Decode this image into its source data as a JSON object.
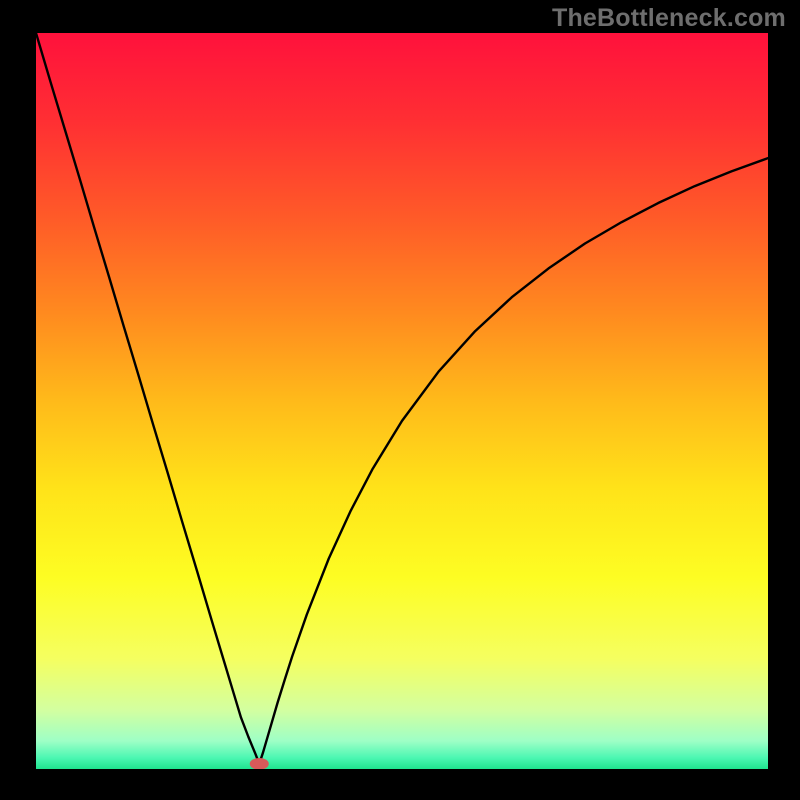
{
  "watermark": "TheBottleneck.com",
  "colors": {
    "gradient_stops": [
      {
        "offset": 0.0,
        "color": "#ff113c"
      },
      {
        "offset": 0.12,
        "color": "#ff2f33"
      },
      {
        "offset": 0.25,
        "color": "#ff5a28"
      },
      {
        "offset": 0.38,
        "color": "#ff8a1f"
      },
      {
        "offset": 0.5,
        "color": "#ffba1a"
      },
      {
        "offset": 0.62,
        "color": "#ffe319"
      },
      {
        "offset": 0.74,
        "color": "#fdfd23"
      },
      {
        "offset": 0.85,
        "color": "#f5ff60"
      },
      {
        "offset": 0.92,
        "color": "#d3ffa0"
      },
      {
        "offset": 0.962,
        "color": "#9effc6"
      },
      {
        "offset": 0.985,
        "color": "#4bf7b2"
      },
      {
        "offset": 1.0,
        "color": "#1fe38e"
      }
    ],
    "curve": "#000000",
    "marker": "#d85a5a",
    "background": "#000000"
  },
  "chart_data": {
    "type": "line",
    "title": "",
    "xlabel": "",
    "ylabel": "",
    "xlim": [
      0,
      100
    ],
    "ylim": [
      0,
      100
    ],
    "marker": {
      "x": 30.5,
      "y": 0.7,
      "rx": 1.3,
      "ry": 0.8
    },
    "series": [
      {
        "name": "bottleneck-curve",
        "x": [
          0,
          2,
          4,
          6,
          8,
          10,
          12,
          14,
          16,
          18,
          20,
          22,
          24,
          25,
          26,
          27,
          28,
          29,
          30,
          30.5,
          31,
          32,
          33,
          34,
          35,
          37,
          40,
          43,
          46,
          50,
          55,
          60,
          65,
          70,
          75,
          80,
          85,
          90,
          95,
          100
        ],
        "y": [
          100,
          93.3,
          86.7,
          80.1,
          73.4,
          66.8,
          60.1,
          53.5,
          46.8,
          40.2,
          33.5,
          26.9,
          20.2,
          16.9,
          13.6,
          10.3,
          7,
          4.4,
          2,
          0.7,
          2.2,
          5.6,
          9,
          12.2,
          15.3,
          21,
          28.6,
          35.1,
          40.8,
          47.3,
          54,
          59.5,
          64.1,
          68,
          71.4,
          74.3,
          76.9,
          79.2,
          81.2,
          83
        ]
      }
    ]
  }
}
